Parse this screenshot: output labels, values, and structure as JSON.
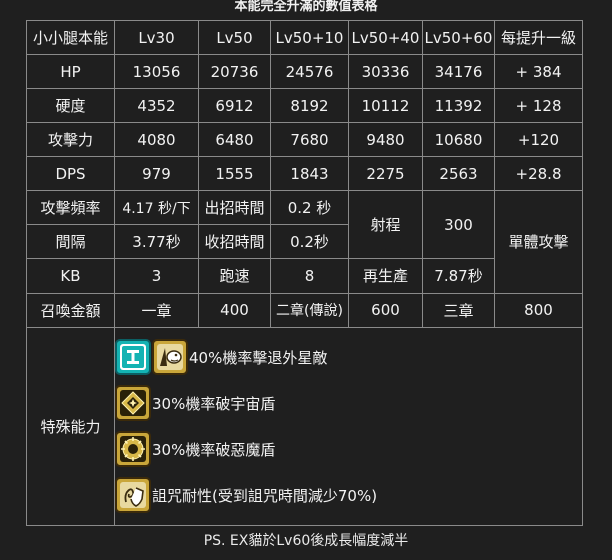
{
  "title": "本能完全升滿的數值表格",
  "table": {
    "header": [
      "小小腿本能",
      "Lv30",
      "Lv50",
      "Lv50+10",
      "Lv50+40",
      "Lv50+60",
      "每提升一級"
    ],
    "stat_rows": [
      {
        "label": "HP",
        "values": [
          "13056",
          "20736",
          "24576",
          "30336",
          "34176",
          "+ 384"
        ]
      },
      {
        "label": "硬度",
        "values": [
          "4352",
          "6912",
          "8192",
          "10112",
          "11392",
          "+ 128"
        ]
      },
      {
        "label": "攻擊力",
        "values": [
          "4080",
          "6480",
          "7680",
          "9480",
          "10680",
          "+120"
        ]
      },
      {
        "label": "DPS",
        "values": [
          "979",
          "1555",
          "1843",
          "2275",
          "2563",
          "+28.8"
        ]
      }
    ],
    "attack_freq_label": "攻擊頻率",
    "attack_freq_value": "4.17 秒/下",
    "windup_label": "出招時間",
    "windup_value": "0.2 秒",
    "range_label": "射程",
    "range_value": "300",
    "target_type": "單體攻擊",
    "interval_label": "間隔",
    "interval_value": "3.77秒",
    "recovery_label": "收招時間",
    "recovery_value": "0.2秒",
    "kb_label": "KB",
    "kb_value": "3",
    "speed_label": "跑速",
    "speed_value": "8",
    "respawn_label": "再生產",
    "respawn_value": "7.87秒",
    "cost_label": "召喚金額",
    "cost_values": [
      "一章",
      "400",
      "二章(傳說)",
      "600",
      "三章",
      "800"
    ],
    "special_label": "特殊能力",
    "abilities": [
      {
        "text": "40%機率擊退外星敵",
        "icons": [
          "alien-target-icon",
          "knockback-icon"
        ]
      },
      {
        "text": "30%機率破宇宙盾",
        "icons": [
          "break-starred-shield-icon"
        ]
      },
      {
        "text": "30%機率破惡魔盾",
        "icons": [
          "break-demon-shield-icon"
        ]
      },
      {
        "text": "詛咒耐性(受到詛咒時間減少70%)",
        "icons": [
          "curse-resistance-icon"
        ]
      }
    ]
  },
  "footnote": "PS. EX貓於Lv60後成長幅度減半",
  "colors": {
    "background": "#1f1f1f",
    "border": "#8a8a8a",
    "text": "#f2f2f2",
    "alien_icon": "#14b3b3",
    "ability_icon_gold": "#c9a63a"
  }
}
